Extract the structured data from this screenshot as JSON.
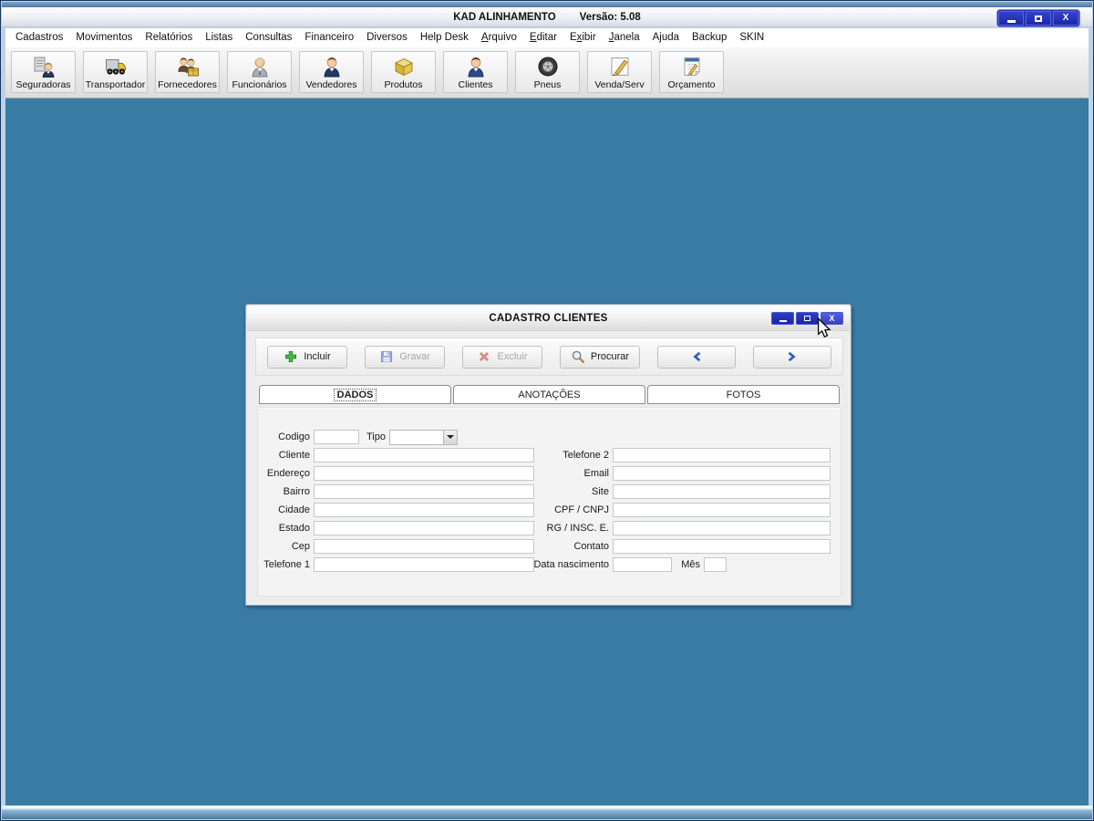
{
  "window": {
    "title": "KAD ALINHAMENTO",
    "version": "Versão: 5.08",
    "controls": [
      "minimize",
      "maximize",
      "close"
    ]
  },
  "menu": {
    "items": [
      {
        "label": "Cadastros",
        "u": -1
      },
      {
        "label": "Movimentos",
        "u": -1
      },
      {
        "label": "Relatórios",
        "u": -1
      },
      {
        "label": "Listas",
        "u": -1
      },
      {
        "label": "Consultas",
        "u": -1
      },
      {
        "label": "Financeiro",
        "u": -1
      },
      {
        "label": "Diversos",
        "u": -1
      },
      {
        "label": "Help Desk",
        "u": -1
      },
      {
        "label": "Arquivo",
        "u": 0
      },
      {
        "label": "Editar",
        "u": 0
      },
      {
        "label": "Exibir",
        "u": 1
      },
      {
        "label": "Janela",
        "u": 0
      },
      {
        "label": "Ajuda",
        "u": -1
      },
      {
        "label": "Backup",
        "u": -1
      },
      {
        "label": "SKIN",
        "u": -1
      }
    ]
  },
  "toolbar": {
    "buttons": [
      {
        "label": "Seguradoras",
        "icon": "insurer-icon"
      },
      {
        "label": "Transportador",
        "icon": "truck-icon"
      },
      {
        "label": "Fornecedores",
        "icon": "suppliers-icon"
      },
      {
        "label": "Funcionários",
        "icon": "employee-icon"
      },
      {
        "label": "Vendedores",
        "icon": "salesman-icon"
      },
      {
        "label": "Produtos",
        "icon": "products-box-icon"
      },
      {
        "label": "Clientes",
        "icon": "client-icon"
      },
      {
        "label": "Pneus",
        "icon": "tire-icon"
      },
      {
        "label": "Venda/Serv",
        "icon": "sale-service-icon"
      },
      {
        "label": "Orçamento",
        "icon": "quote-icon"
      }
    ]
  },
  "dialog": {
    "title": "CADASTRO CLIENTES",
    "controls": [
      "minimize",
      "maximize",
      "close"
    ],
    "actions": [
      {
        "label": "Incluir",
        "icon": "plus-icon",
        "enabled": true
      },
      {
        "label": "Gravar",
        "icon": "save-icon",
        "enabled": false
      },
      {
        "label": "Excluir",
        "icon": "delete-icon",
        "enabled": false
      },
      {
        "label": "Procurar",
        "icon": "search-icon",
        "enabled": true
      },
      {
        "label": "",
        "icon": "arrow-left-icon",
        "enabled": true
      },
      {
        "label": "",
        "icon": "arrow-right-icon",
        "enabled": true
      }
    ],
    "tabs": [
      {
        "label": "DADOS",
        "active": true
      },
      {
        "label": "ANOTAÇÕES",
        "active": false
      },
      {
        "label": "FOTOS",
        "active": false
      }
    ],
    "form": {
      "codigo_label": "Codigo",
      "codigo_value": "",
      "tipo_label": "Tipo",
      "tipo_value": "",
      "left_fields": [
        {
          "label": "Cliente",
          "value": ""
        },
        {
          "label": "Endereço",
          "value": ""
        },
        {
          "label": "Bairro",
          "value": ""
        },
        {
          "label": "Cidade",
          "value": ""
        },
        {
          "label": "Estado",
          "value": ""
        },
        {
          "label": "Cep",
          "value": ""
        },
        {
          "label": "Telefone 1",
          "value": ""
        }
      ],
      "right_fields": [
        {
          "label": "Telefone 2",
          "value": ""
        },
        {
          "label": "Email",
          "value": ""
        },
        {
          "label": "Site",
          "value": ""
        },
        {
          "label": "CPF / CNPJ",
          "value": ""
        },
        {
          "label": "RG / INSC. E.",
          "value": ""
        },
        {
          "label": "Contato",
          "value": ""
        }
      ],
      "data_nascimento_label": "Data nascimento",
      "data_nascimento_value": "",
      "mes_label": "Mês",
      "mes_value": ""
    }
  },
  "colors": {
    "desktop_background": "#3A7BA4",
    "titlebar_button_blue": "#1B28AE",
    "accent_blue": "#2B5FC4",
    "disabled_text": "#A6A6A6"
  }
}
